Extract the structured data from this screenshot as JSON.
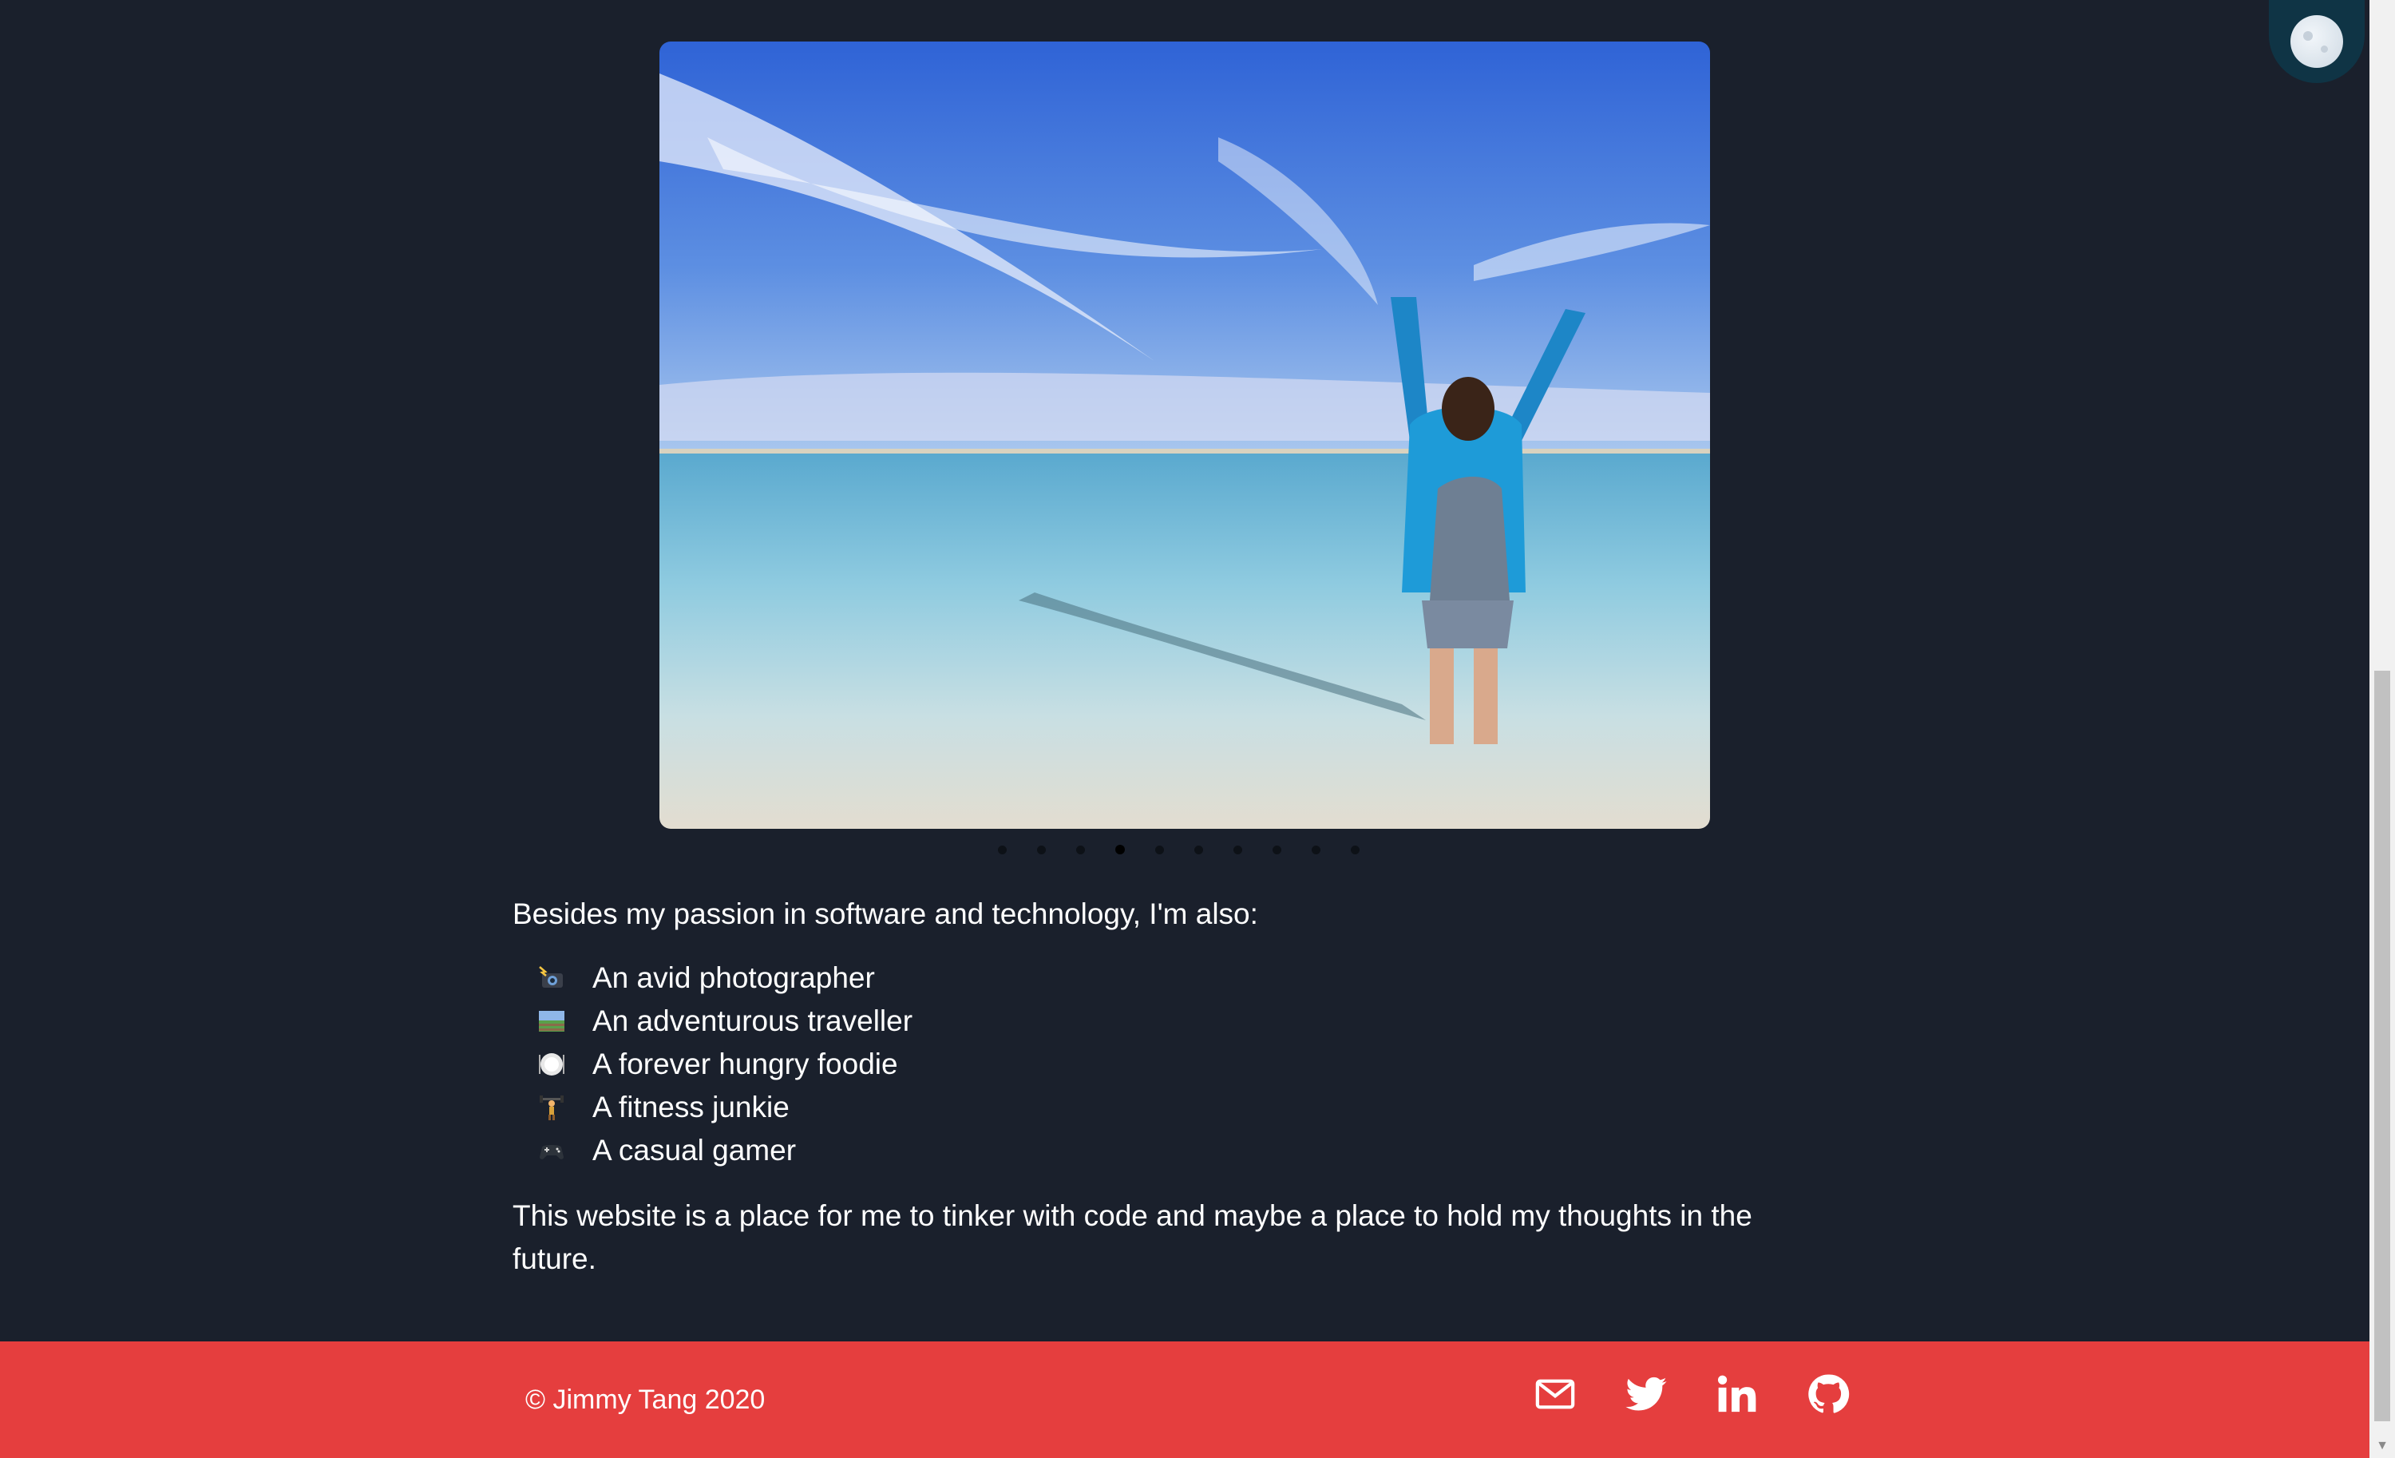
{
  "theme_toggle": {
    "icon": "moon-icon"
  },
  "carousel": {
    "image_alt": "photo",
    "slide_count": 10,
    "active_index": 3
  },
  "about": {
    "intro": "Besides my passion in software and technology, I'm also:",
    "hobbies": [
      {
        "icon": "camera-flash-icon",
        "label": "An avid photographer"
      },
      {
        "icon": "railway-track-icon",
        "label": "An adventurous traveller"
      },
      {
        "icon": "plate-icon",
        "label": "A forever hungry foodie"
      },
      {
        "icon": "weightlifter-icon",
        "label": "A fitness junkie"
      },
      {
        "icon": "game-controller-icon",
        "label": "A casual gamer"
      }
    ],
    "closing": "This website is a place for me to tinker with code and maybe a place to hold my thoughts in the future."
  },
  "footer": {
    "copyright": "© Jimmy Tang 2020",
    "background": "#e53e3e",
    "social": [
      {
        "name": "email",
        "icon": "mail-icon"
      },
      {
        "name": "twitter",
        "icon": "twitter-icon"
      },
      {
        "name": "linkedin",
        "icon": "linkedin-icon"
      },
      {
        "name": "github",
        "icon": "github-icon"
      }
    ]
  },
  "colors": {
    "page_bg": "#1a202c",
    "text": "#ffffff"
  }
}
